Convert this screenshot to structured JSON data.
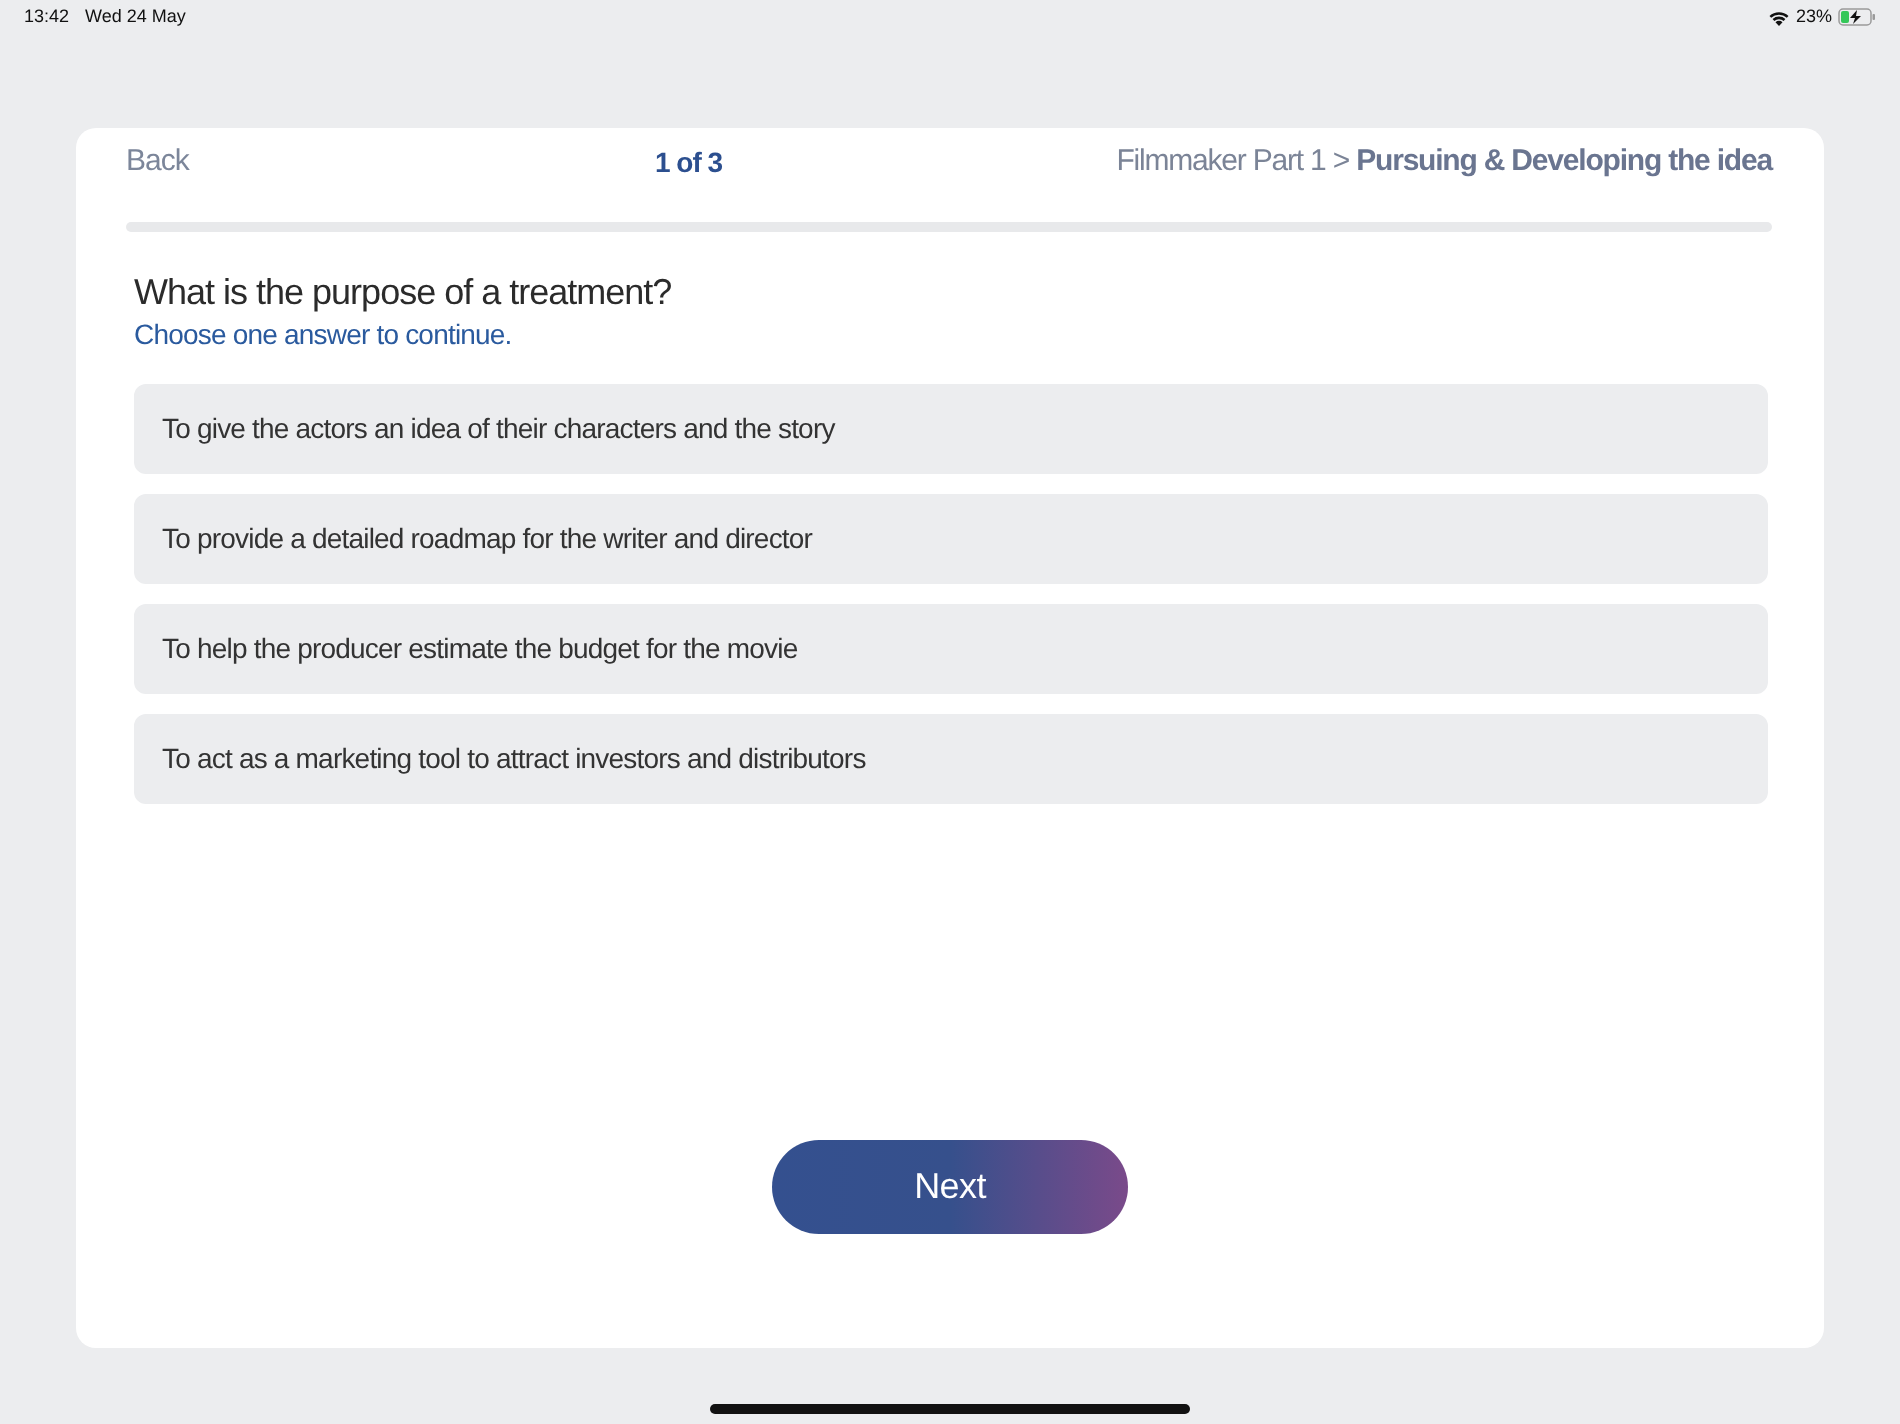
{
  "status_bar": {
    "time": "13:42",
    "date": "Wed 24 May",
    "battery": "23%"
  },
  "header": {
    "back": "Back",
    "step": "1 of 3",
    "breadcrumb": "Filmmaker Part 1 > **Pursuing & Developing the idea**"
  },
  "question": {
    "text": "What is the purpose of a treatment?",
    "instruction": "Choose one answer to continue."
  },
  "answers": [
    {
      "text": "To give the actors an idea of their characters and the story",
      "selected": false
    },
    {
      "text": "To provide a detailed roadmap for the writer and director",
      "selected": false
    },
    {
      "text": "To help the producer estimate the budget for the movie",
      "selected": false
    },
    {
      "text": "To act as a marketing tool to attract investors and distributors",
      "selected": false
    }
  ],
  "next_button": {
    "label": "Next"
  }
}
